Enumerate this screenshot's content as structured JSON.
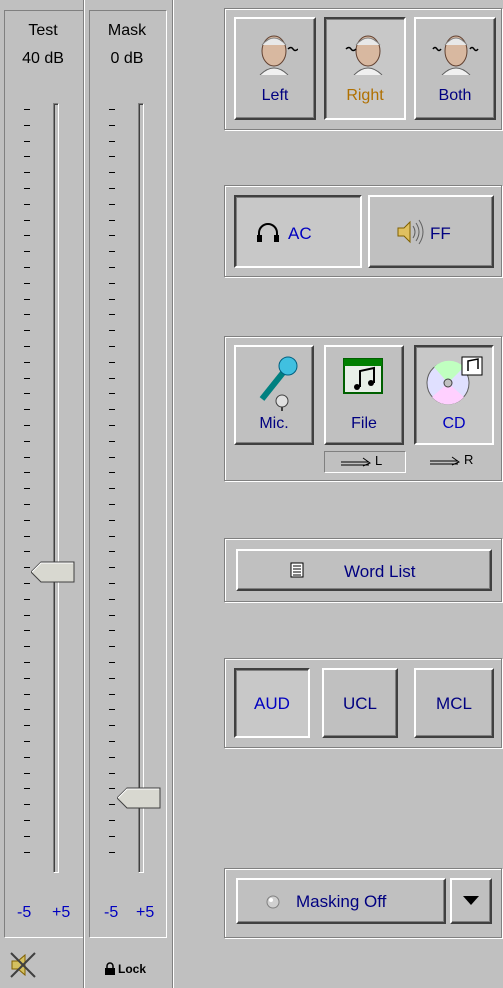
{
  "test": {
    "title": "Test",
    "level": "40 dB",
    "scale_min": "-5",
    "scale_max": "+5"
  },
  "mask": {
    "title": "Mask",
    "level": "0 dB",
    "scale_min": "-5",
    "scale_max": "+5"
  },
  "ear": {
    "left": "Left",
    "right": "Right",
    "both": "Both",
    "selected": "Right"
  },
  "transducer": {
    "ac": "AC",
    "ff": "FF",
    "selected": "AC"
  },
  "source": {
    "mic": "Mic.",
    "file": "File",
    "cd": "CD",
    "file_route": "L",
    "cd_route": "R",
    "selected": "CD"
  },
  "word_list": {
    "label": "Word List"
  },
  "modes": {
    "aud": "AUD",
    "ucl": "UCL",
    "mcl": "MCL",
    "selected": "AUD"
  },
  "masking": {
    "label": "Masking Off"
  },
  "footer": {
    "lock": "Lock"
  }
}
